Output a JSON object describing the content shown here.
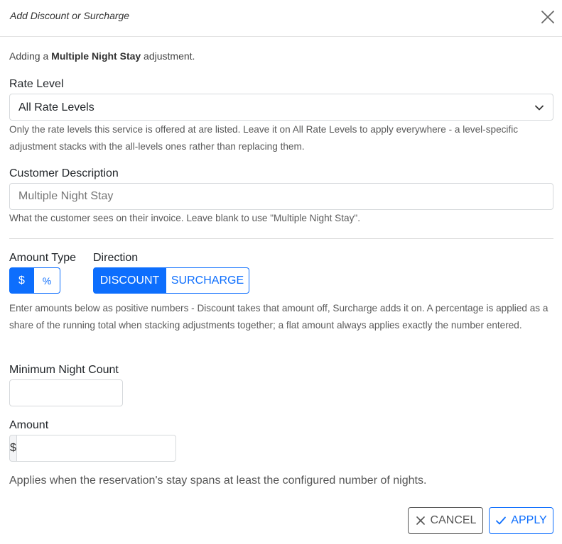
{
  "header": {
    "title": "Add Discount or Surcharge"
  },
  "intro": {
    "prefix": "Adding a ",
    "adjustment_name": "Multiple Night Stay",
    "suffix": " adjustment."
  },
  "rate_level": {
    "label": "Rate Level",
    "selected": "All Rate Levels",
    "help": "Only the rate levels this service is offered at are listed. Leave it on All Rate Levels to apply everywhere - a level-specific adjustment stacks with the all-levels ones rather than replacing them."
  },
  "customer_description": {
    "label": "Customer Description",
    "placeholder": "Multiple Night Stay",
    "help": "What the customer sees on their invoice. Leave blank to use \"Multiple Night Stay\"."
  },
  "amount_type": {
    "label": "Amount Type",
    "options": [
      "$",
      "%"
    ],
    "selected": "$"
  },
  "direction": {
    "label": "Direction",
    "options": [
      "DISCOUNT",
      "SURCHARGE"
    ],
    "selected": "DISCOUNT"
  },
  "amount_help": "Enter amounts below as positive numbers - Discount takes that amount off, Surcharge adds it on. A percentage is applied as a share of the running total when stacking adjustments together; a flat amount always applies exactly the number entered.",
  "minimum_night_count": {
    "label": "Minimum Night Count",
    "value": ""
  },
  "amount": {
    "label": "Amount",
    "prefix": "$",
    "value": ""
  },
  "footer_note": "Applies when the reservation's stay spans at least the configured number of nights.",
  "actions": {
    "cancel_label": "CANCEL",
    "apply_label": "APPLY"
  },
  "colors": {
    "primary": "#0d6efd",
    "border": "#d6d9dc",
    "muted_text": "#5a5a5a"
  },
  "icons": {
    "close": "close-icon",
    "chevron": "chevron-down-icon",
    "cancel": "x-icon",
    "apply": "check-icon"
  }
}
